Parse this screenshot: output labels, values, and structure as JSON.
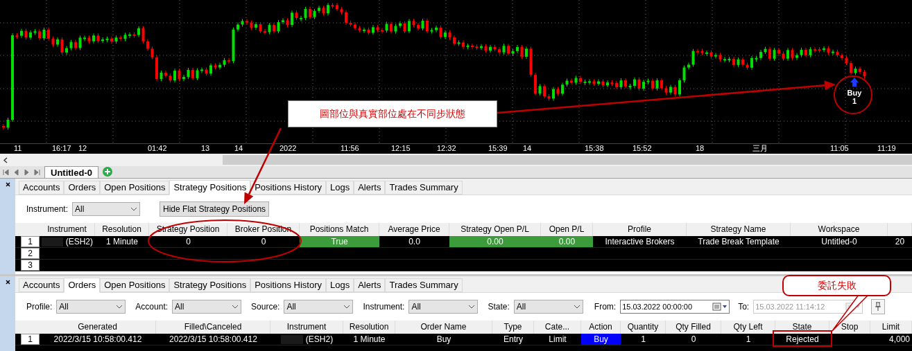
{
  "chart": {
    "axis_labels": [
      "11",
      "16:17",
      "12",
      "01:42",
      "13",
      "14",
      "2022",
      "11:56",
      "12:15",
      "12:32",
      "15:39",
      "14",
      "15:38",
      "15:52",
      "18",
      "三月",
      "11:05",
      "11:19"
    ],
    "marker": {
      "label": "Buy",
      "quantity": "1"
    }
  },
  "document_tabs": [
    {
      "label": "Untitled-0",
      "selected": true
    }
  ],
  "panels": [
    {
      "tabs": [
        {
          "label": "Accounts",
          "selected": false
        },
        {
          "label": "Orders",
          "selected": false
        },
        {
          "label": "Open Positions",
          "selected": false
        },
        {
          "label": "Strategy Positions",
          "selected": true
        },
        {
          "label": "Positions History",
          "selected": false
        },
        {
          "label": "Logs",
          "selected": false
        },
        {
          "label": "Alerts",
          "selected": false
        },
        {
          "label": "Trades Summary",
          "selected": false
        }
      ],
      "filters": [
        {
          "kind": "dropdown",
          "label": "Instrument:",
          "value": "All"
        },
        {
          "kind": "button",
          "value": "Hide Flat Strategy Positions"
        }
      ],
      "table": {
        "columns": [
          "Instrument",
          "Resolution",
          "Strategy Position",
          "Broker Position",
          "Positions Match",
          "Average Price",
          "Strategy Open P/L",
          "Open P/L",
          "Profile",
          "Strategy Name",
          "Workspace",
          ""
        ],
        "rows": [
          {
            "number": "1",
            "cells": [
              {
                "text": "(ESH2)",
                "redacted": true
              },
              {
                "text": "1 Minute"
              },
              {
                "text": "0"
              },
              {
                "text": "0"
              },
              {
                "text": "True",
                "color": "#3c9c3c"
              },
              {
                "text": "0.0"
              },
              {
                "text": "0.00",
                "color": "#3c9c3c"
              },
              {
                "text": "0.00",
                "color": "#3c9c3c"
              },
              {
                "text": "Interactive Brokers"
              },
              {
                "text": "Trade Break Template"
              },
              {
                "text": "Untitled-0"
              },
              {
                "text": "20"
              }
            ]
          },
          {
            "number": "2",
            "cells": []
          },
          {
            "number": "3",
            "cells": []
          }
        ]
      }
    },
    {
      "tabs": [
        {
          "label": "Accounts",
          "selected": false
        },
        {
          "label": "Orders",
          "selected": true
        },
        {
          "label": "Open Positions",
          "selected": false
        },
        {
          "label": "Strategy Positions",
          "selected": false
        },
        {
          "label": "Positions History",
          "selected": false
        },
        {
          "label": "Logs",
          "selected": false
        },
        {
          "label": "Alerts",
          "selected": false
        },
        {
          "label": "Trades Summary",
          "selected": false
        }
      ],
      "filters": [
        {
          "kind": "dropdown",
          "label": "Profile:",
          "value": "All"
        },
        {
          "kind": "dropdown",
          "label": "Account:",
          "value": "All"
        },
        {
          "kind": "dropdown",
          "label": "Source:",
          "value": "All"
        },
        {
          "kind": "dropdown",
          "label": "Instrument:",
          "value": "All"
        },
        {
          "kind": "dropdown",
          "label": "State:",
          "value": "All"
        },
        {
          "kind": "date",
          "label": "From:",
          "value": "15.03.2022 00:00:00",
          "disabled": false
        },
        {
          "kind": "date",
          "label": "To:",
          "value": "15.03.2022 11:14:12",
          "disabled": true
        },
        {
          "kind": "pin"
        }
      ],
      "table": {
        "columns": [
          "Generated",
          "Filled\\Canceled",
          "Instrument",
          "Resolution",
          "Order Name",
          "Type",
          "Cate...",
          "Action",
          "Quantity",
          "Qty Filled",
          "Qty Left",
          "State",
          "Stop",
          "Limit"
        ],
        "rows": [
          {
            "number": "1",
            "cells": [
              {
                "text": "2022/3/15 10:58:00.412"
              },
              {
                "text": "2022/3/15 10:58:00.412"
              },
              {
                "text": "(ESH2)",
                "redacted": true
              },
              {
                "text": "1 Minute"
              },
              {
                "text": "Buy"
              },
              {
                "text": "Entry"
              },
              {
                "text": "Limit"
              },
              {
                "text": "Buy",
                "color": "#0000ff"
              },
              {
                "text": "1"
              },
              {
                "text": "0"
              },
              {
                "text": "1"
              },
              {
                "text": "Rejected"
              },
              {
                "text": ""
              },
              {
                "text": "4,000"
              }
            ]
          }
        ]
      }
    }
  ],
  "annotations": [
    {
      "kind": "textbox",
      "text": "圖部位與真實部位處在不同步狀態"
    },
    {
      "kind": "callout",
      "text": "委託失敗"
    }
  ]
}
